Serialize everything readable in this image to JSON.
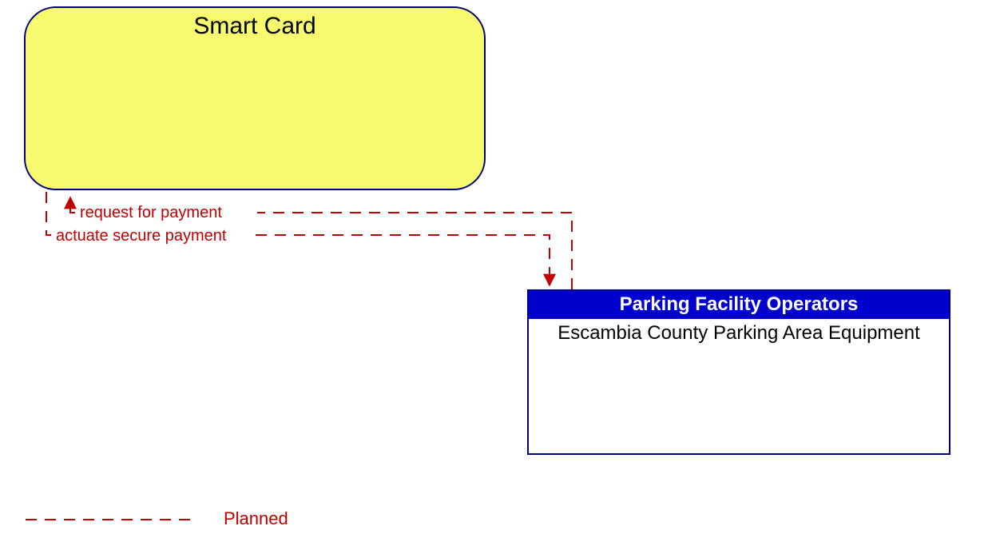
{
  "nodes": {
    "smart_card": {
      "title": "Smart Card"
    },
    "parking": {
      "header": "Parking Facility Operators",
      "body": "Escambia County Parking Area Equipment"
    }
  },
  "flows": {
    "to_smartcard": "request for payment",
    "to_parking": "actuate secure payment"
  },
  "legend": {
    "planned": "Planned"
  },
  "style": {
    "dash_color": "#c00000",
    "node_border": "#000080",
    "smartcard_fill": "#f7fa6f",
    "parking_header_bg": "#0000cc"
  }
}
